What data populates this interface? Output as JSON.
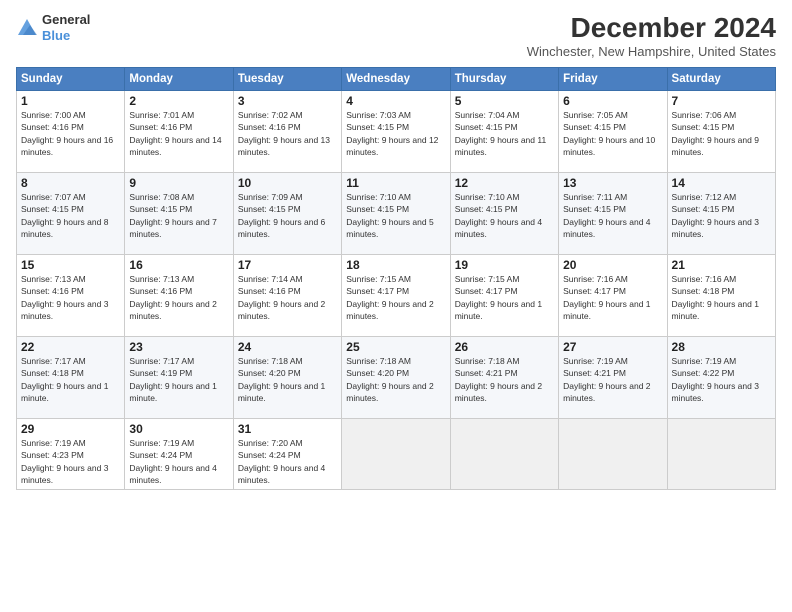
{
  "header": {
    "logo_general": "General",
    "logo_blue": "Blue",
    "title": "December 2024",
    "location": "Winchester, New Hampshire, United States"
  },
  "weekdays": [
    "Sunday",
    "Monday",
    "Tuesday",
    "Wednesday",
    "Thursday",
    "Friday",
    "Saturday"
  ],
  "weeks": [
    [
      {
        "day": "1",
        "sunrise": "7:00 AM",
        "sunset": "4:16 PM",
        "daylight": "9 hours and 16 minutes."
      },
      {
        "day": "2",
        "sunrise": "7:01 AM",
        "sunset": "4:16 PM",
        "daylight": "9 hours and 14 minutes."
      },
      {
        "day": "3",
        "sunrise": "7:02 AM",
        "sunset": "4:16 PM",
        "daylight": "9 hours and 13 minutes."
      },
      {
        "day": "4",
        "sunrise": "7:03 AM",
        "sunset": "4:15 PM",
        "daylight": "9 hours and 12 minutes."
      },
      {
        "day": "5",
        "sunrise": "7:04 AM",
        "sunset": "4:15 PM",
        "daylight": "9 hours and 11 minutes."
      },
      {
        "day": "6",
        "sunrise": "7:05 AM",
        "sunset": "4:15 PM",
        "daylight": "9 hours and 10 minutes."
      },
      {
        "day": "7",
        "sunrise": "7:06 AM",
        "sunset": "4:15 PM",
        "daylight": "9 hours and 9 minutes."
      }
    ],
    [
      {
        "day": "8",
        "sunrise": "7:07 AM",
        "sunset": "4:15 PM",
        "daylight": "9 hours and 8 minutes."
      },
      {
        "day": "9",
        "sunrise": "7:08 AM",
        "sunset": "4:15 PM",
        "daylight": "9 hours and 7 minutes."
      },
      {
        "day": "10",
        "sunrise": "7:09 AM",
        "sunset": "4:15 PM",
        "daylight": "9 hours and 6 minutes."
      },
      {
        "day": "11",
        "sunrise": "7:10 AM",
        "sunset": "4:15 PM",
        "daylight": "9 hours and 5 minutes."
      },
      {
        "day": "12",
        "sunrise": "7:10 AM",
        "sunset": "4:15 PM",
        "daylight": "9 hours and 4 minutes."
      },
      {
        "day": "13",
        "sunrise": "7:11 AM",
        "sunset": "4:15 PM",
        "daylight": "9 hours and 4 minutes."
      },
      {
        "day": "14",
        "sunrise": "7:12 AM",
        "sunset": "4:15 PM",
        "daylight": "9 hours and 3 minutes."
      }
    ],
    [
      {
        "day": "15",
        "sunrise": "7:13 AM",
        "sunset": "4:16 PM",
        "daylight": "9 hours and 3 minutes."
      },
      {
        "day": "16",
        "sunrise": "7:13 AM",
        "sunset": "4:16 PM",
        "daylight": "9 hours and 2 minutes."
      },
      {
        "day": "17",
        "sunrise": "7:14 AM",
        "sunset": "4:16 PM",
        "daylight": "9 hours and 2 minutes."
      },
      {
        "day": "18",
        "sunrise": "7:15 AM",
        "sunset": "4:17 PM",
        "daylight": "9 hours and 2 minutes."
      },
      {
        "day": "19",
        "sunrise": "7:15 AM",
        "sunset": "4:17 PM",
        "daylight": "9 hours and 1 minute."
      },
      {
        "day": "20",
        "sunrise": "7:16 AM",
        "sunset": "4:17 PM",
        "daylight": "9 hours and 1 minute."
      },
      {
        "day": "21",
        "sunrise": "7:16 AM",
        "sunset": "4:18 PM",
        "daylight": "9 hours and 1 minute."
      }
    ],
    [
      {
        "day": "22",
        "sunrise": "7:17 AM",
        "sunset": "4:18 PM",
        "daylight": "9 hours and 1 minute."
      },
      {
        "day": "23",
        "sunrise": "7:17 AM",
        "sunset": "4:19 PM",
        "daylight": "9 hours and 1 minute."
      },
      {
        "day": "24",
        "sunrise": "7:18 AM",
        "sunset": "4:20 PM",
        "daylight": "9 hours and 1 minute."
      },
      {
        "day": "25",
        "sunrise": "7:18 AM",
        "sunset": "4:20 PM",
        "daylight": "9 hours and 2 minutes."
      },
      {
        "day": "26",
        "sunrise": "7:18 AM",
        "sunset": "4:21 PM",
        "daylight": "9 hours and 2 minutes."
      },
      {
        "day": "27",
        "sunrise": "7:19 AM",
        "sunset": "4:21 PM",
        "daylight": "9 hours and 2 minutes."
      },
      {
        "day": "28",
        "sunrise": "7:19 AM",
        "sunset": "4:22 PM",
        "daylight": "9 hours and 3 minutes."
      }
    ],
    [
      {
        "day": "29",
        "sunrise": "7:19 AM",
        "sunset": "4:23 PM",
        "daylight": "9 hours and 3 minutes."
      },
      {
        "day": "30",
        "sunrise": "7:19 AM",
        "sunset": "4:24 PM",
        "daylight": "9 hours and 4 minutes."
      },
      {
        "day": "31",
        "sunrise": "7:20 AM",
        "sunset": "4:24 PM",
        "daylight": "9 hours and 4 minutes."
      },
      null,
      null,
      null,
      null
    ]
  ],
  "labels": {
    "sunrise": "Sunrise:",
    "sunset": "Sunset:",
    "daylight": "Daylight:"
  }
}
